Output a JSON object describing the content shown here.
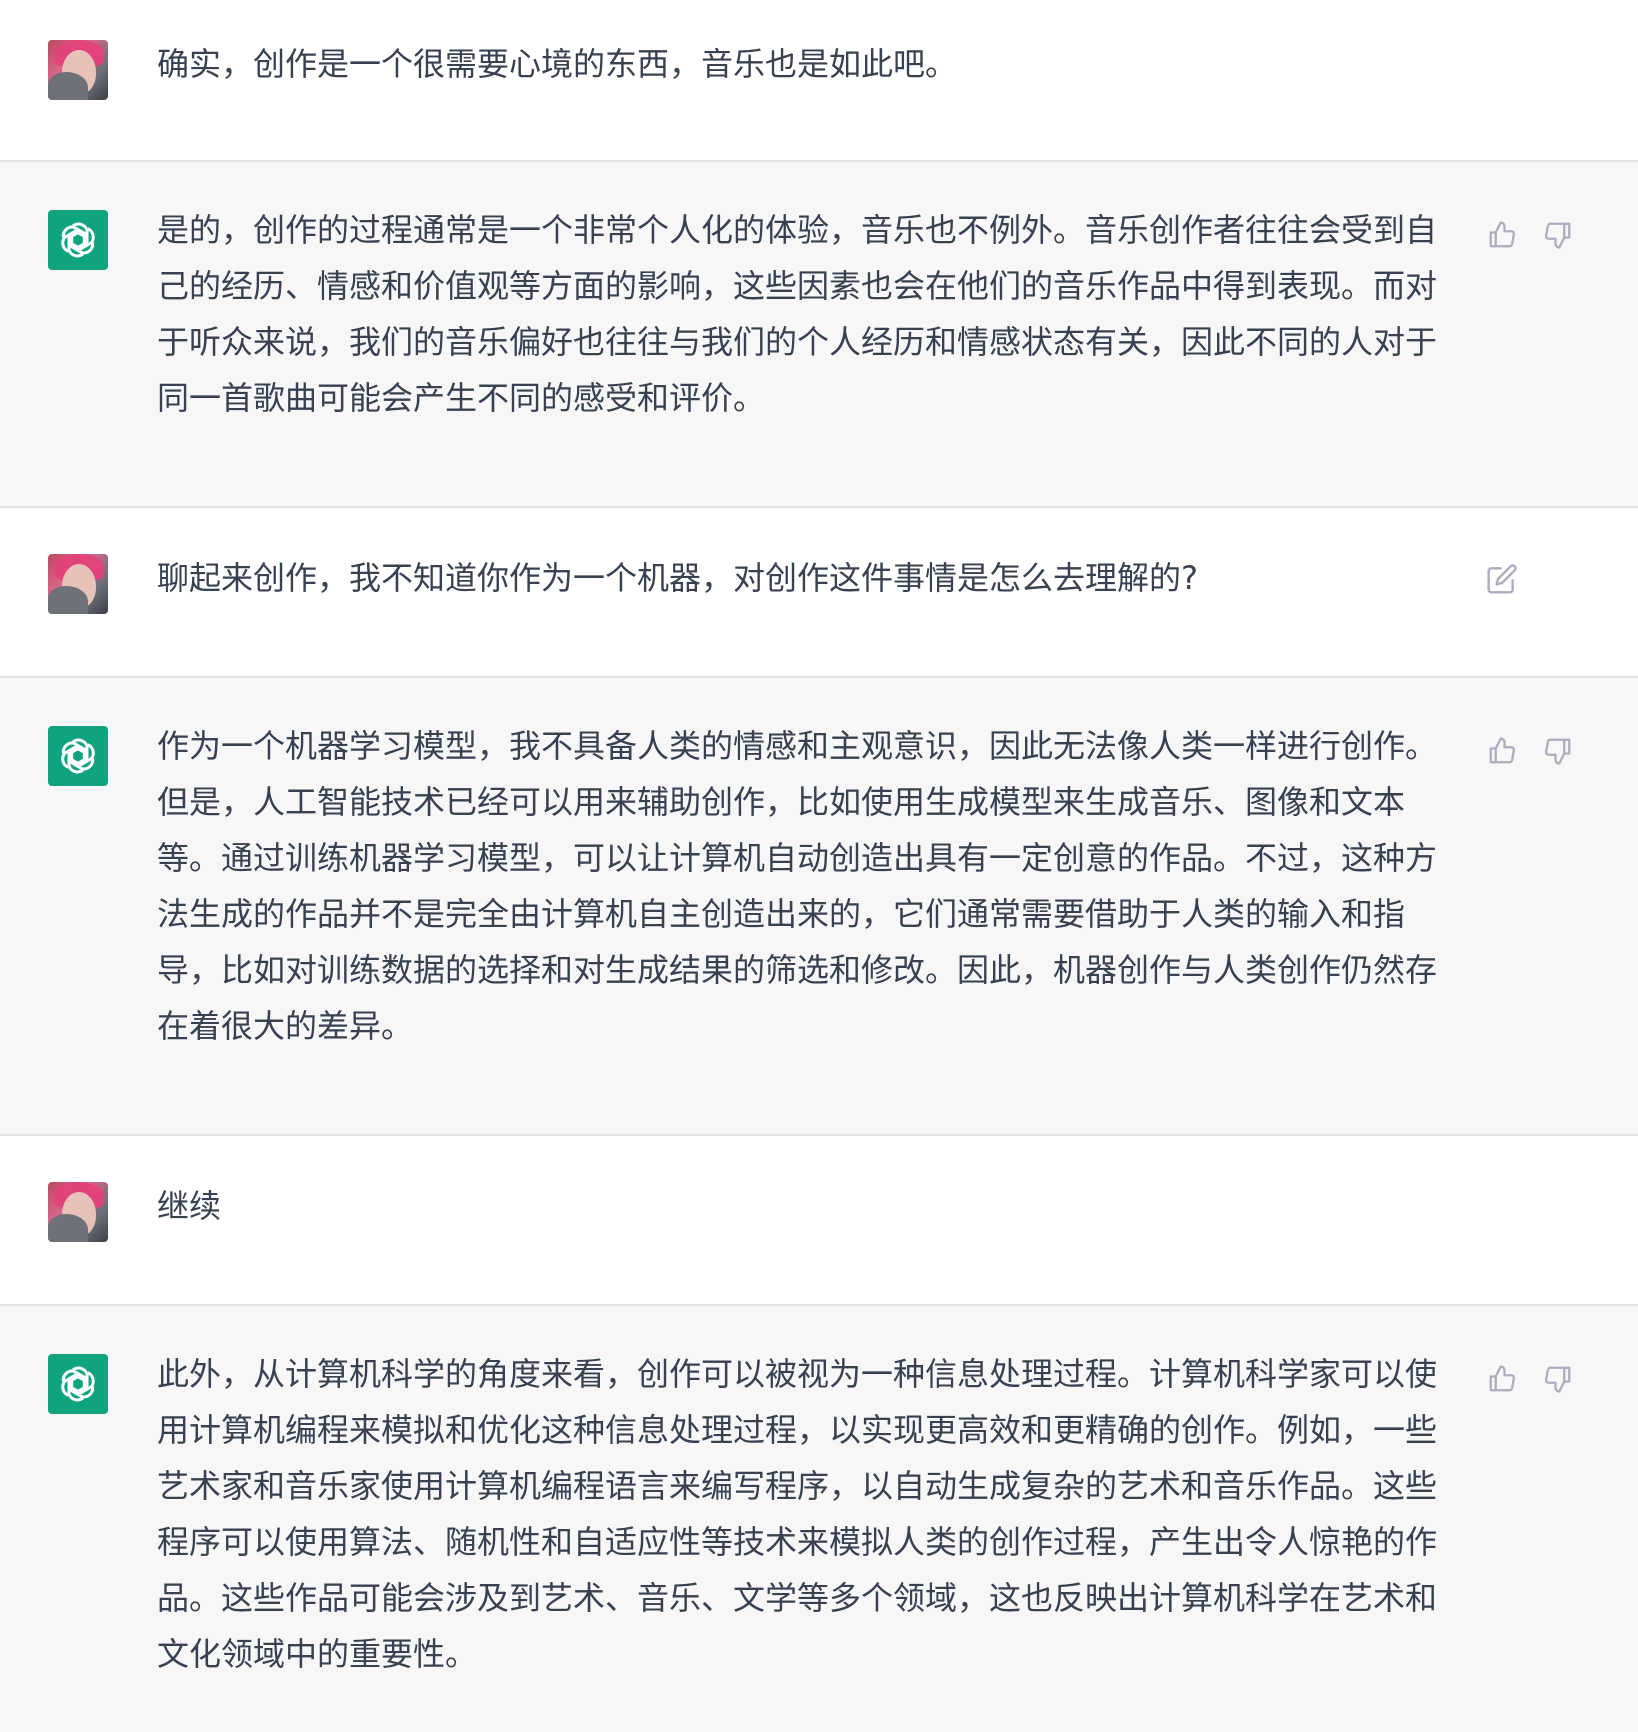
{
  "conversation": {
    "messages": [
      {
        "role": "user",
        "text": "确实，创作是一个很需要心境的东西，音乐也是如此吧。"
      },
      {
        "role": "assistant",
        "text": "是的，创作的过程通常是一个非常个人化的体验，音乐也不例外。音乐创作者往往会受到自己的经历、情感和价值观等方面的影响，这些因素也会在他们的音乐作品中得到表现。而对于听众来说，我们的音乐偏好也往往与我们的个人经历和情感状态有关，因此不同的人对于同一首歌曲可能会产生不同的感受和评价。"
      },
      {
        "role": "user",
        "text": "聊起来创作，我不知道你作为一个机器，对创作这件事情是怎么去理解的?"
      },
      {
        "role": "assistant",
        "text": "作为一个机器学习模型，我不具备人类的情感和主观意识，因此无法像人类一样进行创作。但是，人工智能技术已经可以用来辅助创作，比如使用生成模型来生成音乐、图像和文本等。通过训练机器学习模型，可以让计算机自动创造出具有一定创意的作品。不过，这种方法生成的作品并不是完全由计算机自主创造出来的，它们通常需要借助于人类的输入和指导，比如对训练数据的选择和对生成结果的筛选和修改。因此，机器创作与人类创作仍然存在着很大的差异。"
      },
      {
        "role": "user",
        "text": "继续"
      },
      {
        "role": "assistant",
        "text": "此外，从计算机科学的角度来看，创作可以被视为一种信息处理过程。计算机科学家可以使用计算机编程来模拟和优化这种信息处理过程，以实现更高效和更精确的创作。例如，一些艺术家和音乐家使用计算机编程语言来编写程序，以自动生成复杂的艺术和音乐作品。这些程序可以使用算法、随机性和自适应性等技术来模拟人类的创作过程，产生出令人惊艳的作品。这些作品可能会涉及到艺术、音乐、文学等多个领域，这也反映出计算机科学在艺术和文化领域中的重要性。"
      }
    ]
  },
  "icons": {
    "user_avatar": "user-avatar-photo",
    "bot_avatar": "openai-logo-icon",
    "like": "thumbs-up-icon",
    "dislike": "thumbs-down-icon",
    "edit": "edit-icon"
  },
  "colors": {
    "user_bg": "#ffffff",
    "assistant_bg": "#f7f7f8",
    "bot_avatar_bg": "#10a37f",
    "text": "#374151",
    "icon": "#acacbe",
    "divider": "#e3e4e8"
  }
}
